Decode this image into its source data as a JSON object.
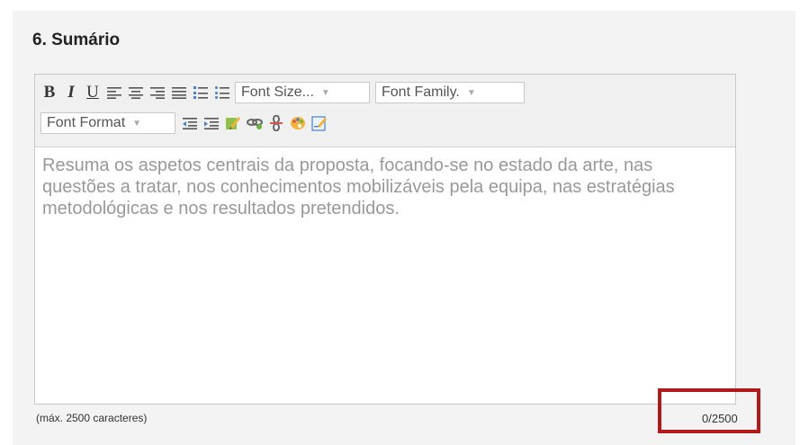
{
  "section": {
    "title": "6. Sumário"
  },
  "toolbar": {
    "bold": "B",
    "italic": "I",
    "underline": "U",
    "font_size": "Font Size...",
    "font_family": "Font Family.",
    "font_format": "Font Format",
    "icons": [
      "align-left-icon",
      "align-center-icon",
      "align-right-icon",
      "align-justify-icon",
      "ordered-list-icon",
      "unordered-list-icon",
      "outdent-icon",
      "indent-icon",
      "edit-icon",
      "link-icon",
      "unlink-icon",
      "color-palette-icon",
      "source-icon"
    ]
  },
  "editor": {
    "placeholder": "Resuma os aspetos centrais da proposta, focando-se no estado da arte, nas questões a tratar, nos conhecimentos mobilizáveis pela equipa, nas estratégias metodológicas e nos resultados pretendidos."
  },
  "footer": {
    "limit_hint": "(máx. 2500 caracteres)",
    "counter": "0/2500"
  },
  "colors": {
    "highlight": "#b01a1a",
    "placeholder_text": "#999999",
    "panel_background": "#f3f3f3"
  }
}
